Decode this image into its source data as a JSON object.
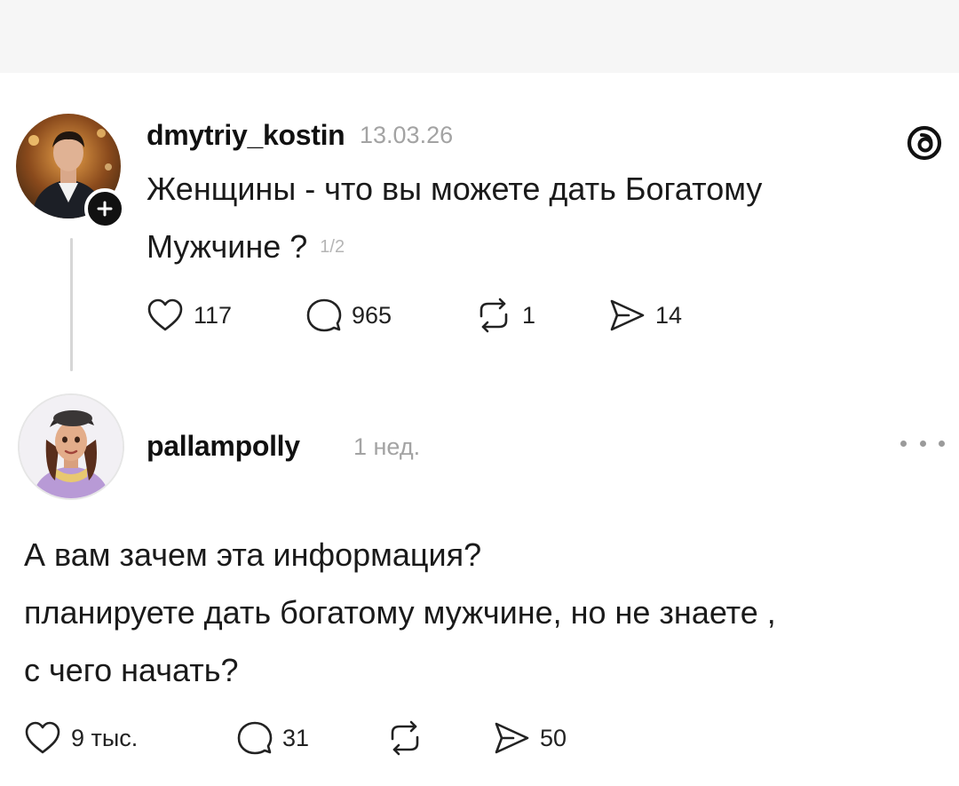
{
  "post1": {
    "username": "dmytriy_kostin",
    "date": "13.03.26",
    "text_line1": "Женщины - что вы можете дать Богатому",
    "text_line2": "Мужчине ?",
    "page_indicator": "1/2",
    "likes": "117",
    "comments": "965",
    "reposts": "1",
    "shares": "14"
  },
  "post2": {
    "username": "pallampolly",
    "time": "1 нед.",
    "text_line1": "А вам зачем эта информация?",
    "text_line2": "планируете дать богатому мужчине, но не знаете ,",
    "text_line3": "с чего начать?",
    "likes": "9 тыс.",
    "comments": "31",
    "reposts": "",
    "shares": "50"
  },
  "icons": {
    "like": "heart-icon",
    "comment": "comment-bubble-icon",
    "repost": "repost-icon",
    "share": "send-icon",
    "logo": "threads-logo-icon",
    "more": "more-horizontal-icon",
    "follow": "plus-icon"
  },
  "colors": {
    "text": "#111111",
    "muted": "#a3a3a3",
    "thread_line": "#d6d6d6"
  }
}
